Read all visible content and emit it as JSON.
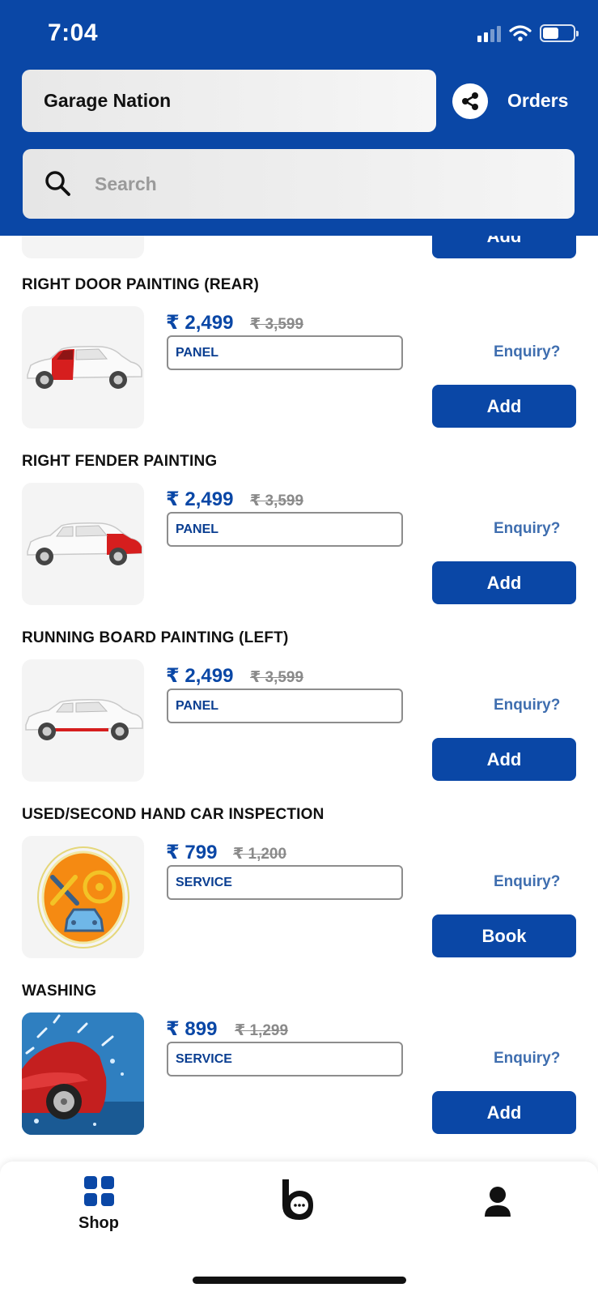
{
  "status_bar": {
    "time": "7:04"
  },
  "header": {
    "title": "Garage Nation",
    "orders_label": "Orders",
    "search_placeholder": "Search"
  },
  "partial_item": {
    "button_label": "Add"
  },
  "products": [
    {
      "name": "RIGHT DOOR PAINTING (REAR)",
      "price": "₹ 2,499",
      "mrp": "₹ 3,599",
      "type": "PANEL",
      "enquiry": "Enquiry?",
      "button": "Add",
      "thumb_icon": "car-right-door-rear-icon"
    },
    {
      "name": "RIGHT FENDER PAINTING",
      "price": "₹ 2,499",
      "mrp": "₹ 3,599",
      "type": "PANEL",
      "enquiry": "Enquiry?",
      "button": "Add",
      "thumb_icon": "car-right-fender-icon"
    },
    {
      "name": "RUNNING BOARD PAINTING (LEFT)",
      "price": "₹ 2,499",
      "mrp": "₹ 3,599",
      "type": "PANEL",
      "enquiry": "Enquiry?",
      "button": "Add",
      "thumb_icon": "car-running-board-icon"
    },
    {
      "name": "USED/SECOND HAND CAR INSPECTION",
      "price": "₹ 799",
      "mrp": "₹ 1,200",
      "type": "SERVICE",
      "enquiry": "Enquiry?",
      "button": "Book",
      "thumb_icon": "car-inspection-icon"
    },
    {
      "name": "WASHING",
      "price": "₹ 899",
      "mrp": "₹ 1,299",
      "type": "SERVICE",
      "enquiry": "Enquiry?",
      "button": "Add",
      "thumb_icon": "car-washing-photo"
    }
  ],
  "bottom_nav": {
    "shop_label": "Shop",
    "center_icon": "chat-logo-icon",
    "profile_icon": "profile-icon"
  },
  "colors": {
    "brand_blue": "#0a47a6",
    "enquiry_blue": "#3f6eaf",
    "strike_gray": "#8a8a8a"
  }
}
